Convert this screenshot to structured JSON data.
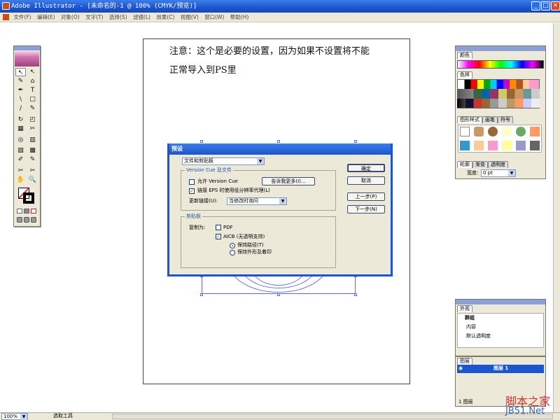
{
  "app": {
    "title": "Adobe Illustrator - [未命名的-1 @ 100% (CMYK/预览)]"
  },
  "menu": [
    "文件(F)",
    "编辑(E)",
    "对象(O)",
    "文字(T)",
    "选择(S)",
    "滤镜(L)",
    "效果(C)",
    "视图(V)",
    "窗口(W)",
    "帮助(H)"
  ],
  "window_buttons": {
    "minimize": "_",
    "maximize": "□",
    "close": "×"
  },
  "artboard": {
    "note_line1": "注意：这个是必要的设置，因为如果不设置将不能",
    "note_line2": "正常导入到PS里"
  },
  "tools": [
    "↖",
    "↖",
    "✎",
    "⌂",
    "✒",
    "T",
    "\\",
    "□",
    "∕",
    "✎",
    "↻",
    "◰",
    "▦",
    "✂",
    "◎",
    "▥",
    "▧",
    "▩",
    "✐",
    "✎",
    "✂",
    "✂",
    "✋",
    "🔍"
  ],
  "panels": {
    "color_tab": "颜色",
    "swatches_tab": "色样",
    "styles_tabs": [
      "图形样式",
      "画笔",
      "符号"
    ],
    "stroke_tabs": [
      "轮廓",
      "渐变",
      "透明度"
    ],
    "stroke_width_label": "宽度:",
    "stroke_width_value": "0 pt",
    "appearance_tab": "外观",
    "appearance_items": [
      "群组",
      "内容",
      "默认透明度"
    ],
    "layers_tab": "图层",
    "layer_name": "图层 1",
    "layers_count": "1 图层"
  },
  "dialog": {
    "title": "预设",
    "section_select": "文件和剪贴板",
    "group1_label": "Version Cue 及文件",
    "enable_version_cue": "允许 Version Cue",
    "tell_more_button": "告诉我更多(I)...",
    "link_eps": "链接 EPS 时使用低分辨率代理(L)",
    "update_links_label": "更新链接(U):",
    "update_links_value": "当修改时询问",
    "group2_label": "剪贴板",
    "copy_as_label": "复制为:",
    "pdf_option": "PDF",
    "aicb_option": "AICB (无透明支持)",
    "preserve_paths": "保持路径(T)",
    "preserve_appearance": "保持外形及着印",
    "ok_button": "确定",
    "cancel_button": "取消",
    "prev_button": "上一步(P)",
    "next_button": "下一步(N)"
  },
  "status": {
    "zoom": "100%",
    "tool": "选取工具"
  },
  "watermark": {
    "line1": "脚本之家",
    "line2": "JB51.Net"
  }
}
